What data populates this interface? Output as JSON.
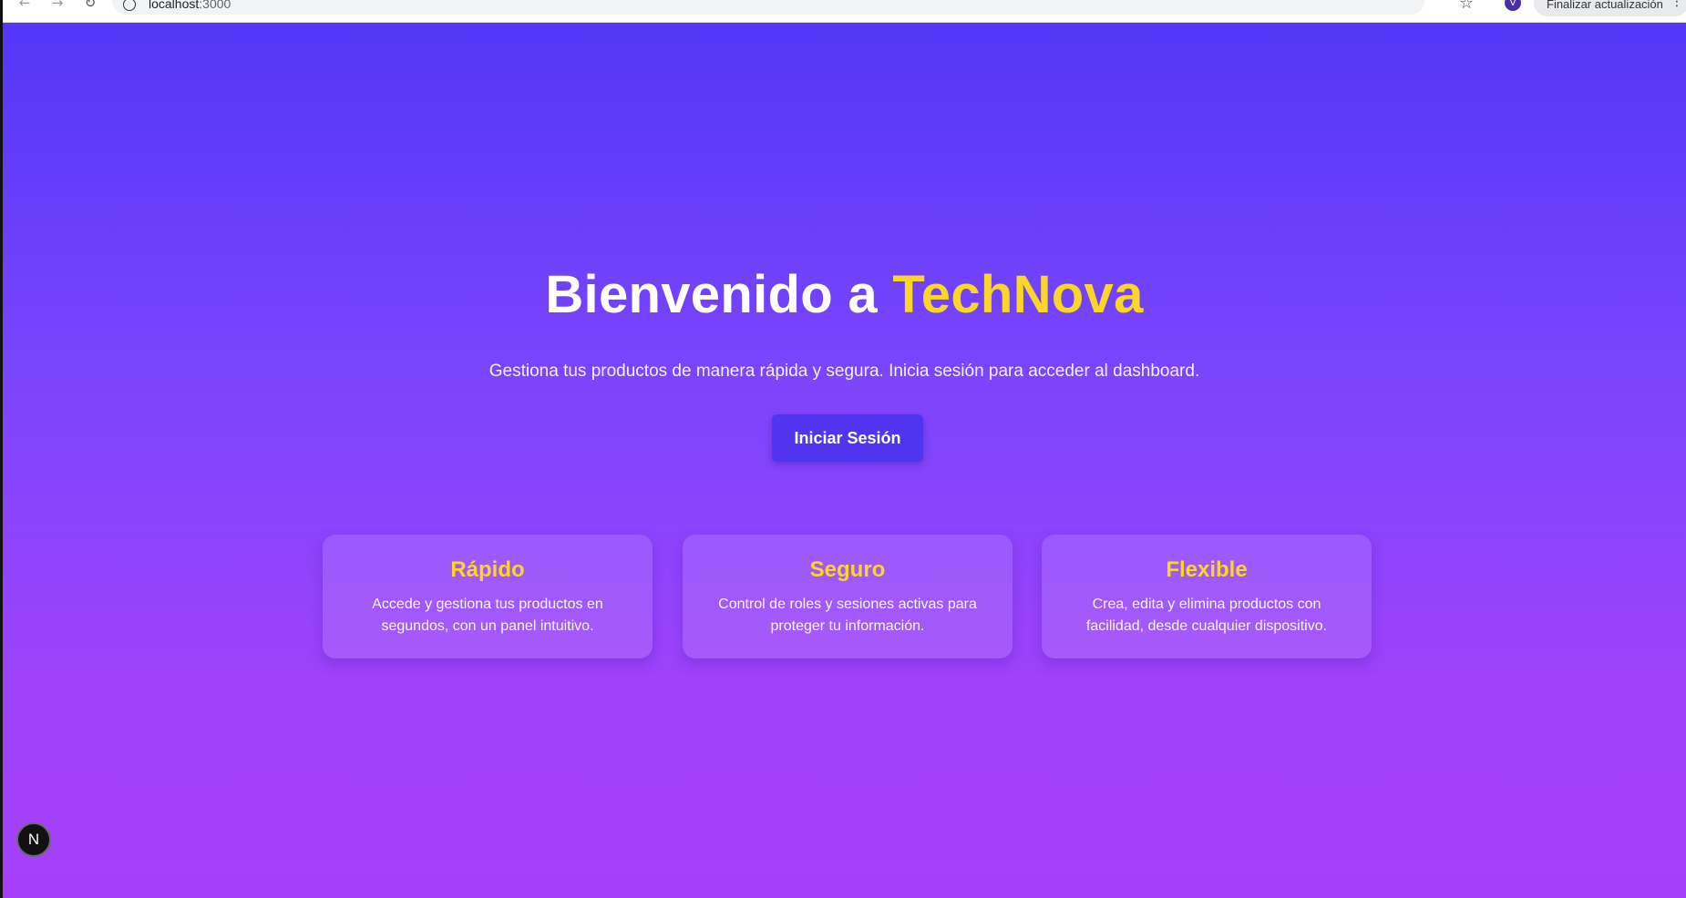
{
  "browser": {
    "url_host": "localhost",
    "url_port": ":3000",
    "profile_initial": "V",
    "update_label": "Finalizar actualización",
    "icons": [
      "back-icon",
      "forward-icon",
      "reload-icon",
      "info-icon",
      "star-icon",
      "kebab-menu-icon"
    ]
  },
  "hero": {
    "title_prefix": "Bienvenido a ",
    "title_brand": "TechNova",
    "subtitle": "Gestiona tus productos de manera rápida y segura. Inicia sesión para acceder al dashboard.",
    "login_label": "Iniciar Sesión"
  },
  "features": [
    {
      "title": "Rápido",
      "description": "Accede y gestiona tus productos en segundos, con un panel intuitivo."
    },
    {
      "title": "Seguro",
      "description": "Control de roles y sesiones activas para proteger tu información."
    },
    {
      "title": "Flexible",
      "description": "Crea, edita y elimina productos con facilidad, desde cualquier dispositivo."
    }
  ],
  "dev_badge": {
    "label": "N"
  },
  "colors": {
    "gradient_top": "#5337f6",
    "gradient_bottom": "#a63ffb",
    "brand_accent": "#fcd529",
    "button_bg": "#4f35ef"
  }
}
